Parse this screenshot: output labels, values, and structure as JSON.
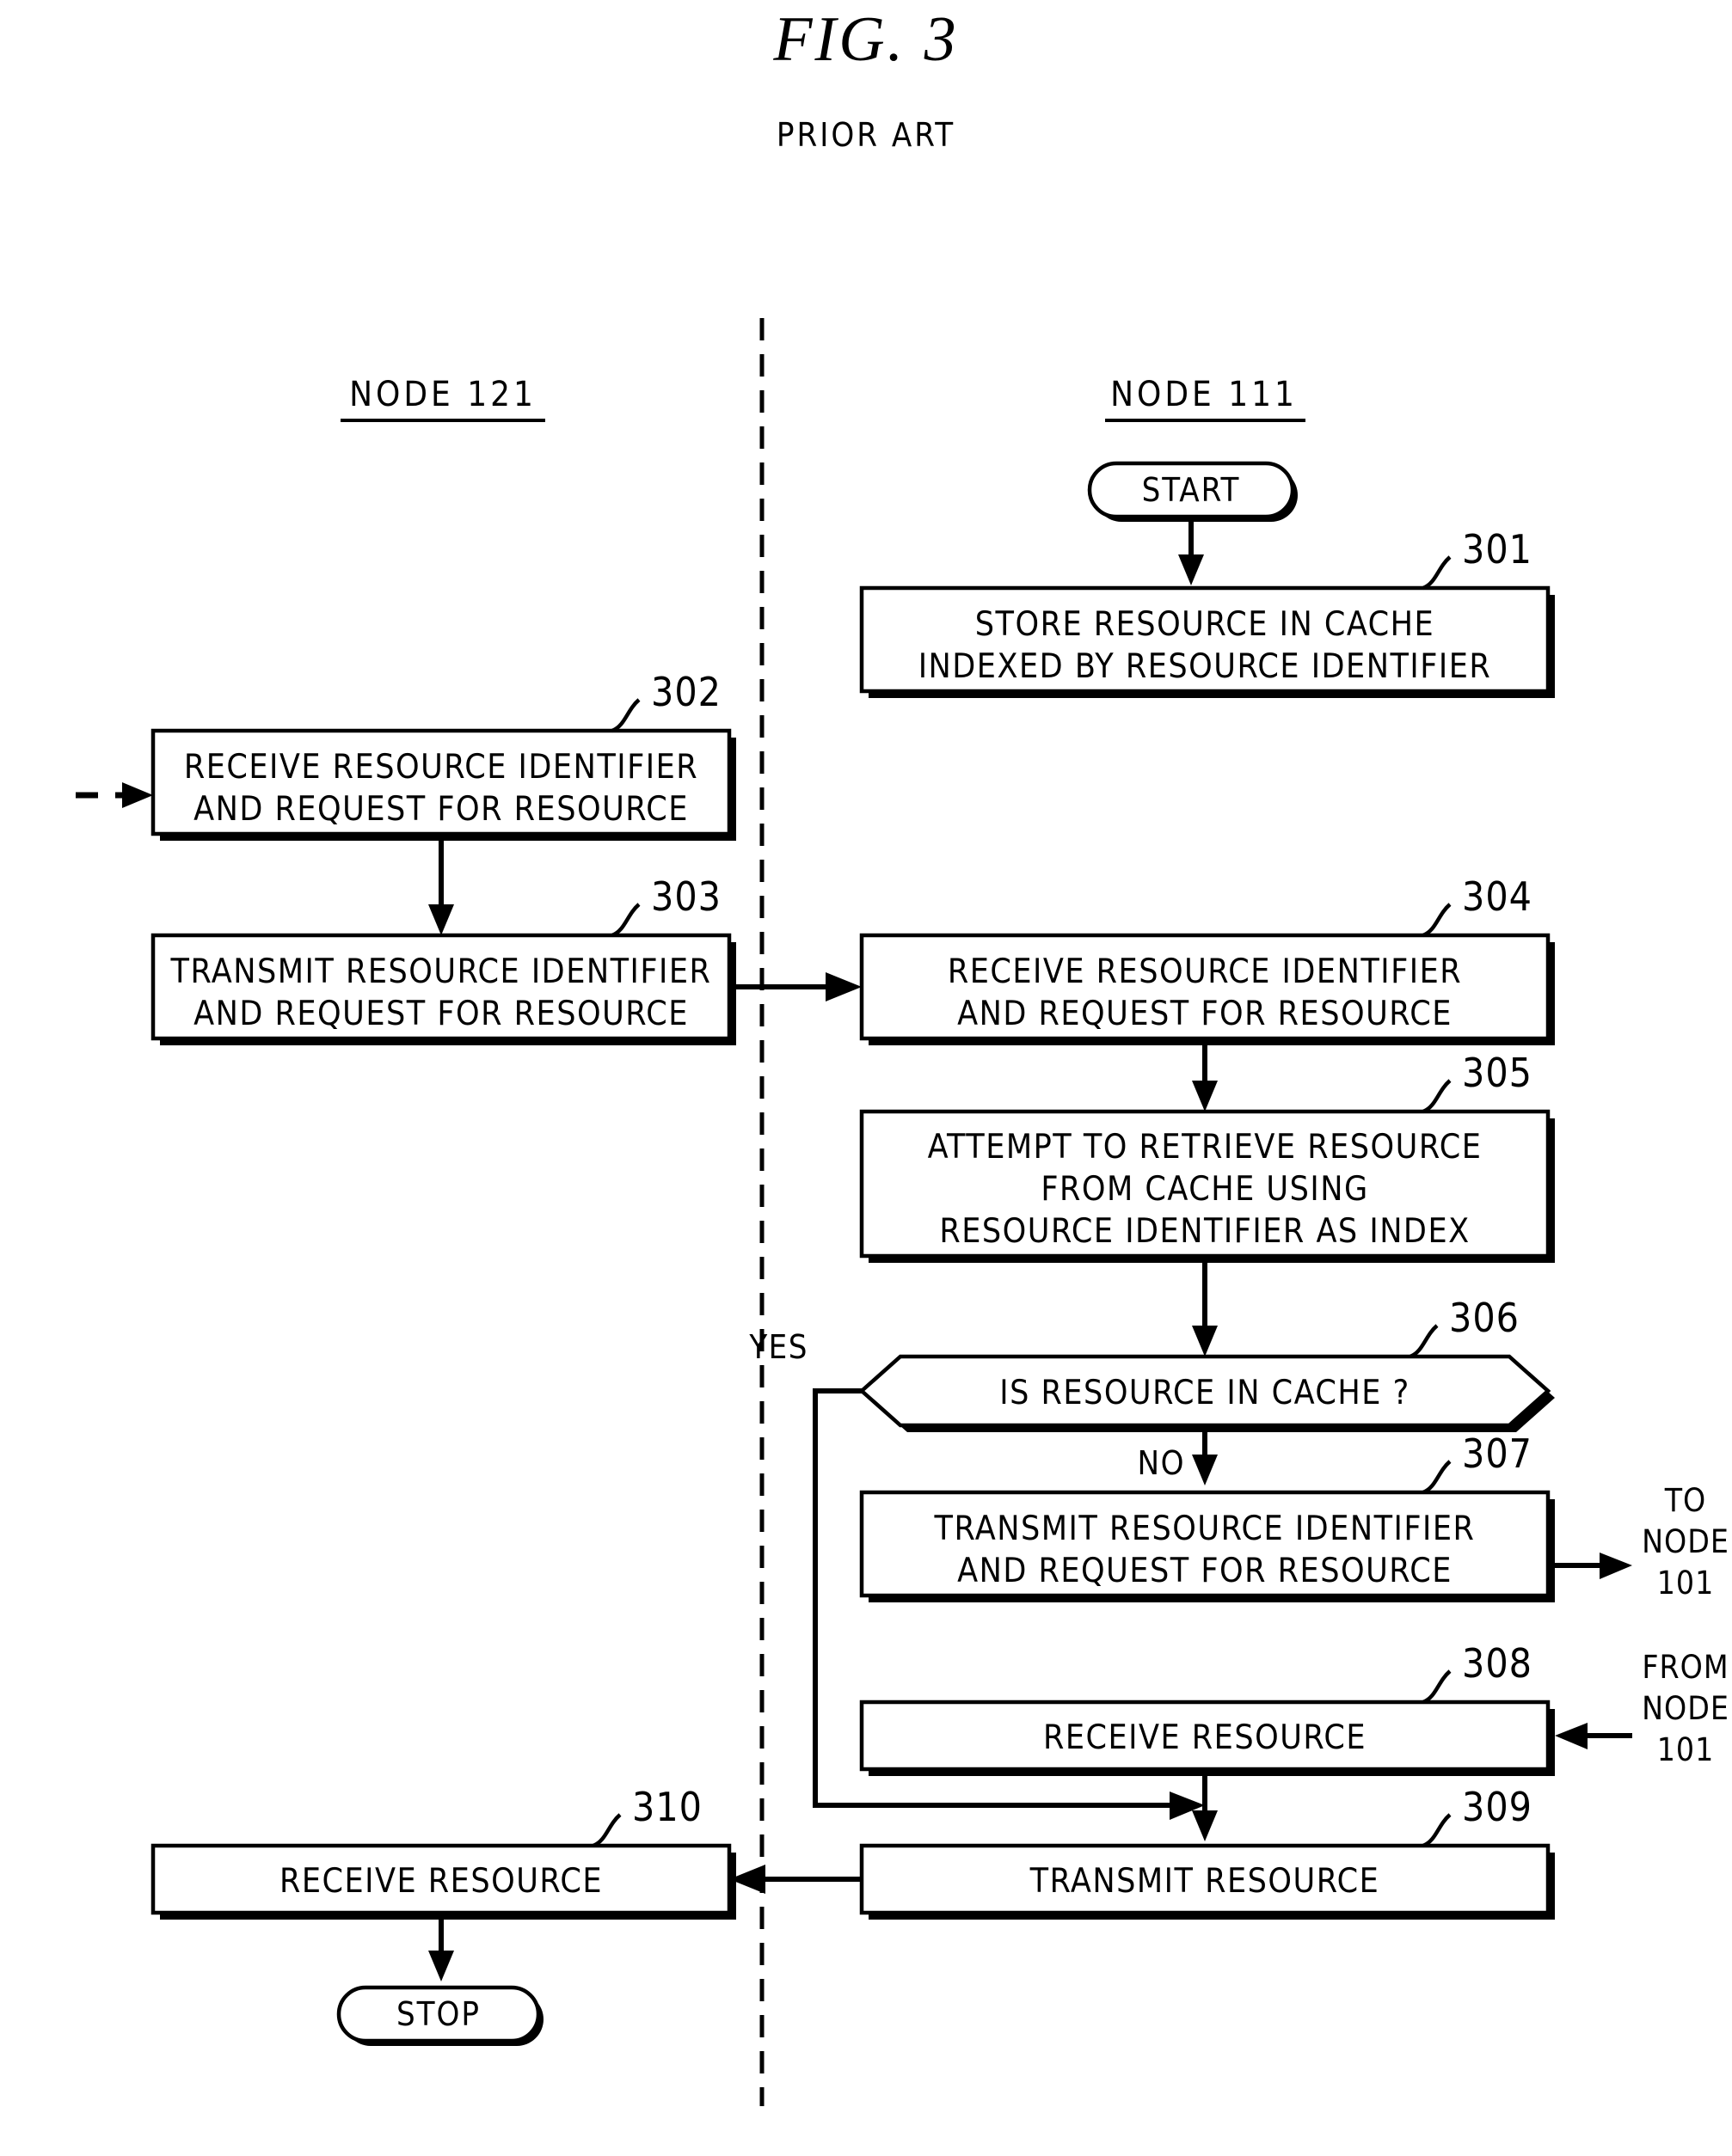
{
  "figure": {
    "title": "FIG.  3",
    "subtitle": "PRIOR ART"
  },
  "columns": [
    {
      "id": "left",
      "label": "NODE 121"
    },
    {
      "id": "right",
      "label": "NODE 111"
    }
  ],
  "terminals": [
    {
      "id": "start",
      "label": "START"
    },
    {
      "id": "stop",
      "label": "STOP"
    }
  ],
  "steps": [
    {
      "ref": "301",
      "column": "right",
      "lines": [
        "STORE RESOURCE IN CACHE",
        "INDEXED BY RESOURCE IDENTIFIER"
      ]
    },
    {
      "ref": "302",
      "column": "left",
      "lines": [
        "RECEIVE RESOURCE IDENTIFIER",
        "AND REQUEST FOR RESOURCE"
      ]
    },
    {
      "ref": "303",
      "column": "left",
      "lines": [
        "TRANSMIT RESOURCE IDENTIFIER",
        "AND REQUEST FOR RESOURCE"
      ]
    },
    {
      "ref": "304",
      "column": "right",
      "lines": [
        "RECEIVE RESOURCE IDENTIFIER",
        "AND REQUEST FOR RESOURCE"
      ]
    },
    {
      "ref": "305",
      "column": "right",
      "lines": [
        "ATTEMPT TO RETRIEVE RESOURCE",
        "FROM CACHE USING",
        "RESOURCE IDENTIFIER AS INDEX"
      ]
    },
    {
      "ref": "306",
      "column": "right",
      "shape": "decision",
      "lines": [
        "IS RESOURCE IN CACHE ?"
      ]
    },
    {
      "ref": "307",
      "column": "right",
      "lines": [
        "TRANSMIT RESOURCE IDENTIFIER",
        "AND REQUEST FOR RESOURCE"
      ]
    },
    {
      "ref": "308",
      "column": "right",
      "lines": [
        "RECEIVE RESOURCE"
      ]
    },
    {
      "ref": "309",
      "column": "right",
      "lines": [
        "TRANSMIT RESOURCE"
      ]
    },
    {
      "ref": "310",
      "column": "left",
      "lines": [
        "RECEIVE RESOURCE"
      ]
    }
  ],
  "edge_labels": {
    "yes": "YES",
    "no": "NO"
  },
  "off_page": {
    "to_node": {
      "line1": "TO",
      "line2": "NODE",
      "line3": "101"
    },
    "from_node": {
      "line1": "FROM",
      "line2": "NODE",
      "line3": "101"
    }
  },
  "colors": {
    "ink": "#000000",
    "paper": "#ffffff"
  }
}
